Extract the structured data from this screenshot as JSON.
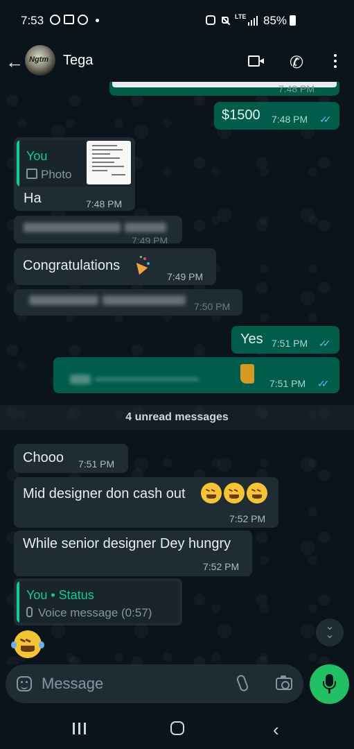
{
  "status_bar": {
    "time": "7:53",
    "network": "LTE",
    "battery": "85%"
  },
  "header": {
    "contact_name": "Tega",
    "avatar_text": "Ngtm"
  },
  "messages": {
    "top_partial_time": "7:48 PM",
    "amount": {
      "text": "$1500",
      "time": "7:48 PM"
    },
    "reply_photo": {
      "quote_author": "You",
      "quote_label": "Photo",
      "text": "Ha",
      "time": "7:48 PM"
    },
    "blurred_1": {
      "time": "7:49 PM"
    },
    "congrats": {
      "text": "Congratulations",
      "time": "7:49 PM"
    },
    "blurred_2": {
      "time": "7:50 PM"
    },
    "yes": {
      "text": "Yes",
      "time": "7:51 PM"
    },
    "blurred_out": {
      "time": "7:51 PM"
    },
    "unread_divider": "4 unread messages",
    "chooo": {
      "text": "Chooo",
      "time": "7:51 PM"
    },
    "mid_designer": {
      "text": "Mid designer don cash out",
      "time": "7:52 PM"
    },
    "senior_designer": {
      "text": "While senior designer Dey hungry",
      "time": "7:52 PM"
    },
    "status_reply": {
      "quote_author": "You • Status",
      "quote_label": "Voice message (0:57)"
    }
  },
  "composer": {
    "placeholder": "Message"
  },
  "icons": {
    "back": "arrow-left",
    "video": "video-camera",
    "call": "phone",
    "menu": "more-vertical",
    "sticker": "sticker",
    "attach": "paperclip",
    "camera": "camera",
    "mic": "microphone"
  },
  "colors": {
    "background": "#0b141a",
    "incoming": "#202c33",
    "outgoing": "#005c4b",
    "accent": "#21c063",
    "read_ticks": "#53bdeb"
  }
}
